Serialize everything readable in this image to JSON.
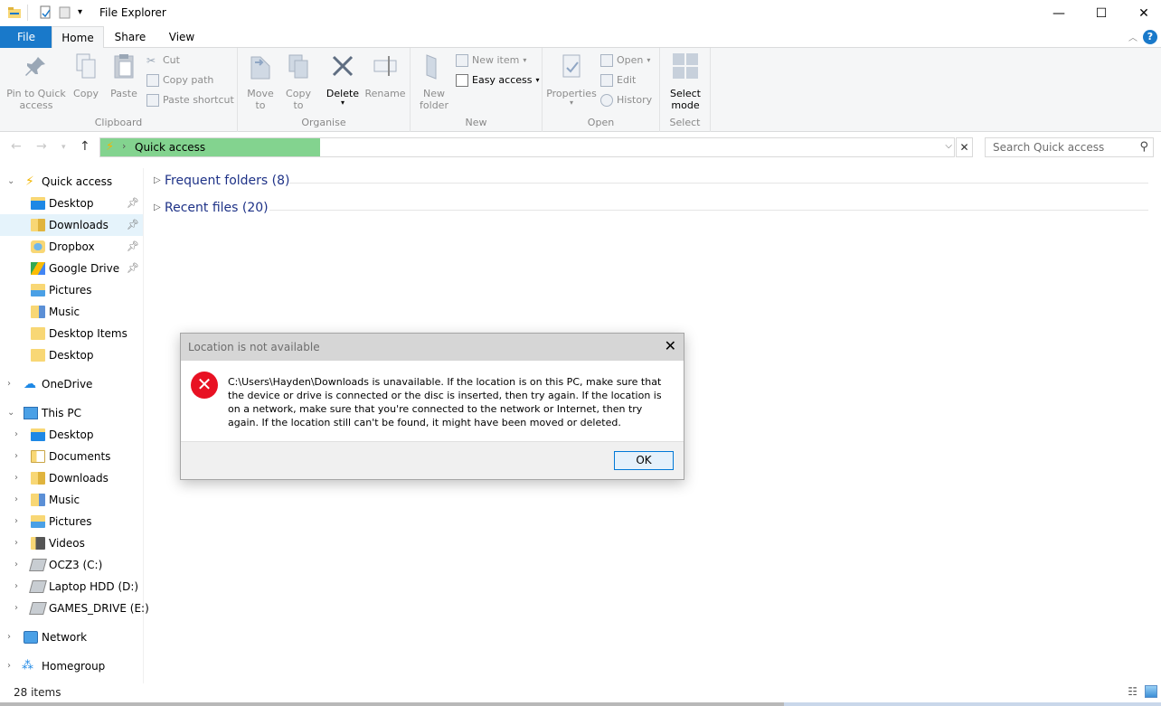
{
  "window": {
    "title": "File Explorer"
  },
  "ribbon_tabs": [
    {
      "label": "File"
    },
    {
      "label": "Home"
    },
    {
      "label": "Share"
    },
    {
      "label": "View"
    }
  ],
  "ribbon": {
    "clipboard": {
      "pin_label": "Pin to Quick access",
      "copy_label": "Copy",
      "paste_label": "Paste",
      "cut_label": "Cut",
      "copy_path_label": "Copy path",
      "paste_shortcut_label": "Paste shortcut",
      "group_label": "Clipboard"
    },
    "organise": {
      "move_to_label": "Move to",
      "copy_to_label": "Copy to",
      "delete_label": "Delete",
      "rename_label": "Rename",
      "group_label": "Organise"
    },
    "new": {
      "new_folder_label": "New folder",
      "new_item_label": "New item",
      "easy_access_label": "Easy access",
      "group_label": "New"
    },
    "open": {
      "properties_label": "Properties",
      "open_label": "Open",
      "edit_label": "Edit",
      "history_label": "History",
      "group_label": "Open"
    },
    "select": {
      "select_mode_label": "Select mode",
      "group_label": "Select"
    }
  },
  "address": {
    "crumb": "Quick access",
    "search_placeholder": "Search Quick access"
  },
  "nav": {
    "quick_access": "Quick access",
    "quick_items": [
      {
        "label": "Desktop",
        "pinned": true
      },
      {
        "label": "Downloads",
        "pinned": true
      },
      {
        "label": "Dropbox",
        "pinned": true
      },
      {
        "label": "Google Drive",
        "pinned": true
      },
      {
        "label": "Pictures",
        "pinned": false
      },
      {
        "label": "Music",
        "pinned": false
      },
      {
        "label": "Desktop Items",
        "pinned": false
      },
      {
        "label": "Desktop",
        "pinned": false
      }
    ],
    "onedrive": "OneDrive",
    "this_pc": "This PC",
    "pc_items": [
      {
        "label": "Desktop"
      },
      {
        "label": "Documents"
      },
      {
        "label": "Downloads"
      },
      {
        "label": "Music"
      },
      {
        "label": "Pictures"
      },
      {
        "label": "Videos"
      },
      {
        "label": "OCZ3 (C:)"
      },
      {
        "label": "Laptop HDD (D:)"
      },
      {
        "label": "GAMES_DRIVE (E:)"
      }
    ],
    "network": "Network",
    "homegroup": "Homegroup"
  },
  "content": {
    "frequent": "Frequent folders (8)",
    "recent": "Recent files (20)"
  },
  "dialog": {
    "title": "Location is not available",
    "message": "C:\\Users\\Hayden\\Downloads is unavailable. If the location is on this PC, make sure that the device or drive is connected or the disc is inserted, then try again. If the location is on a network, make sure that you're connected to the network or Internet, then try again. If the location still can't be found, it might have been moved or deleted.",
    "ok_label": "OK"
  },
  "status": {
    "item_count": "28 items"
  },
  "colors": {
    "accent": "#1979ca",
    "address_fill": "#83d38f",
    "error": "#e81123",
    "link_text": "#1e3287"
  }
}
